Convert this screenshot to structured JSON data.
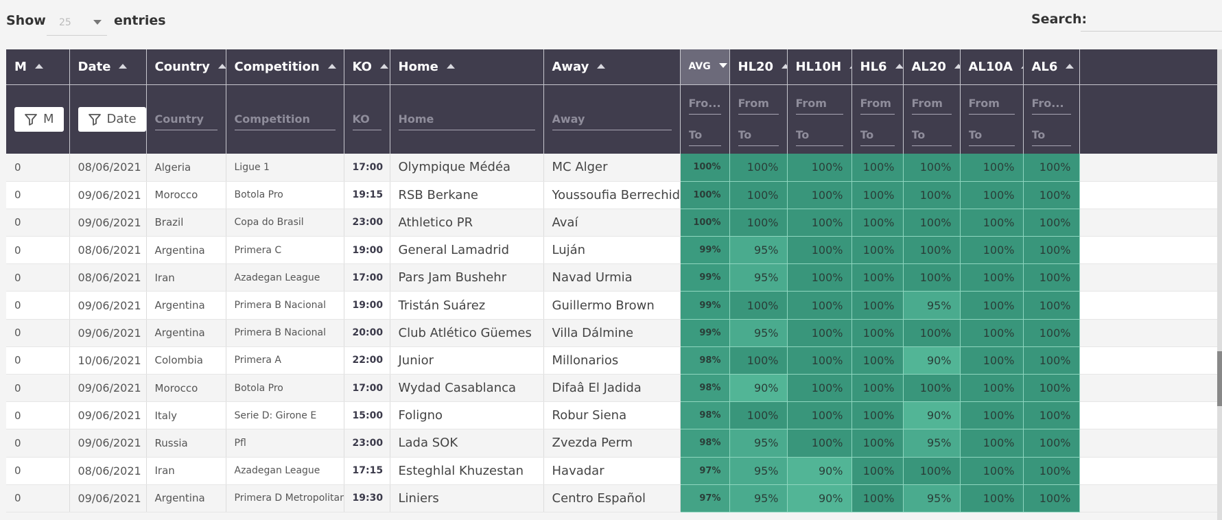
{
  "controls": {
    "show_label": "Show",
    "length_value": "25",
    "entries_label": "entries",
    "search_label": "Search:",
    "search_value": ""
  },
  "columns": [
    "M",
    "Date",
    "Country",
    "Competition",
    "KO",
    "Home",
    "Away",
    "AVG",
    "HL20",
    "HL10H",
    "HL6",
    "AL20",
    "AL10A",
    "AL6"
  ],
  "filters": {
    "m_button": "M",
    "date_button": "Date",
    "country_placeholder": "Country",
    "competition_placeholder": "Competition",
    "ko_placeholder": "KO",
    "home_placeholder": "Home",
    "away_placeholder": "Away",
    "avg_from_placeholder": "Fro...",
    "from_placeholder": "From",
    "to_placeholder": "To"
  },
  "colors": {
    "header_bg": "#403d4d",
    "sorted_header_bg": "#6c6a7a",
    "pct_100": "#39967b",
    "pct_99": "#3b9b7f",
    "pct_98": "#3f9e82",
    "pct_97": "#44a386",
    "pct_95": "#4aab8e",
    "pct_90": "#52b596"
  },
  "rows": [
    {
      "m": "0",
      "date": "08/06/2021",
      "country": "Algeria",
      "competition": "Ligue 1",
      "ko": "17:00",
      "home": "Olympique Médéa",
      "away": "MC Alger",
      "avg": "100%",
      "hl20": "100%",
      "hl10h": "100%",
      "hl6": "100%",
      "al20": "100%",
      "al10a": "100%",
      "al6": "100%"
    },
    {
      "m": "0",
      "date": "09/06/2021",
      "country": "Morocco",
      "competition": "Botola Pro",
      "ko": "19:15",
      "home": "RSB Berkane",
      "away": "Youssoufia Berrechid",
      "avg": "100%",
      "hl20": "100%",
      "hl10h": "100%",
      "hl6": "100%",
      "al20": "100%",
      "al10a": "100%",
      "al6": "100%"
    },
    {
      "m": "0",
      "date": "09/06/2021",
      "country": "Brazil",
      "competition": "Copa do Brasil",
      "ko": "23:00",
      "home": "Athletico PR",
      "away": "Avaí",
      "avg": "100%",
      "hl20": "100%",
      "hl10h": "100%",
      "hl6": "100%",
      "al20": "100%",
      "al10a": "100%",
      "al6": "100%"
    },
    {
      "m": "0",
      "date": "08/06/2021",
      "country": "Argentina",
      "competition": "Primera C",
      "ko": "19:00",
      "home": "General Lamadrid",
      "away": "Luján",
      "avg": "99%",
      "hl20": "95%",
      "hl10h": "100%",
      "hl6": "100%",
      "al20": "100%",
      "al10a": "100%",
      "al6": "100%"
    },
    {
      "m": "0",
      "date": "08/06/2021",
      "country": "Iran",
      "competition": "Azadegan League",
      "ko": "17:00",
      "home": "Pars Jam Bushehr",
      "away": "Navad Urmia",
      "avg": "99%",
      "hl20": "95%",
      "hl10h": "100%",
      "hl6": "100%",
      "al20": "100%",
      "al10a": "100%",
      "al6": "100%"
    },
    {
      "m": "0",
      "date": "09/06/2021",
      "country": "Argentina",
      "competition": "Primera B Nacional",
      "ko": "19:00",
      "home": "Tristán Suárez",
      "away": "Guillermo Brown",
      "avg": "99%",
      "hl20": "100%",
      "hl10h": "100%",
      "hl6": "100%",
      "al20": "95%",
      "al10a": "100%",
      "al6": "100%"
    },
    {
      "m": "0",
      "date": "09/06/2021",
      "country": "Argentina",
      "competition": "Primera B Nacional",
      "ko": "20:00",
      "home": "Club Atlético Güemes",
      "away": "Villa Dálmine",
      "avg": "99%",
      "hl20": "95%",
      "hl10h": "100%",
      "hl6": "100%",
      "al20": "100%",
      "al10a": "100%",
      "al6": "100%"
    },
    {
      "m": "0",
      "date": "10/06/2021",
      "country": "Colombia",
      "competition": "Primera A",
      "ko": "22:00",
      "home": "Junior",
      "away": "Millonarios",
      "avg": "98%",
      "hl20": "100%",
      "hl10h": "100%",
      "hl6": "100%",
      "al20": "90%",
      "al10a": "100%",
      "al6": "100%"
    },
    {
      "m": "0",
      "date": "09/06/2021",
      "country": "Morocco",
      "competition": "Botola Pro",
      "ko": "17:00",
      "home": "Wydad Casablanca",
      "away": "Difaâ El Jadida",
      "avg": "98%",
      "hl20": "90%",
      "hl10h": "100%",
      "hl6": "100%",
      "al20": "100%",
      "al10a": "100%",
      "al6": "100%"
    },
    {
      "m": "0",
      "date": "09/06/2021",
      "country": "Italy",
      "competition": "Serie D: Girone E",
      "ko": "15:00",
      "home": "Foligno",
      "away": "Robur Siena",
      "avg": "98%",
      "hl20": "100%",
      "hl10h": "100%",
      "hl6": "100%",
      "al20": "90%",
      "al10a": "100%",
      "al6": "100%"
    },
    {
      "m": "0",
      "date": "09/06/2021",
      "country": "Russia",
      "competition": "Pfl",
      "ko": "23:00",
      "home": "Lada SOK",
      "away": "Zvezda Perm",
      "avg": "98%",
      "hl20": "95%",
      "hl10h": "100%",
      "hl6": "100%",
      "al20": "95%",
      "al10a": "100%",
      "al6": "100%"
    },
    {
      "m": "0",
      "date": "08/06/2021",
      "country": "Iran",
      "competition": "Azadegan League",
      "ko": "17:15",
      "home": "Esteghlal Khuzestan",
      "away": "Havadar",
      "avg": "97%",
      "hl20": "95%",
      "hl10h": "90%",
      "hl6": "100%",
      "al20": "100%",
      "al10a": "100%",
      "al6": "100%"
    },
    {
      "m": "0",
      "date": "09/06/2021",
      "country": "Argentina",
      "competition": "Primera D Metropolitana",
      "ko": "19:30",
      "home": "Liniers",
      "away": "Centro Español",
      "avg": "97%",
      "hl20": "95%",
      "hl10h": "90%",
      "hl6": "100%",
      "al20": "95%",
      "al10a": "100%",
      "al6": "100%"
    }
  ]
}
